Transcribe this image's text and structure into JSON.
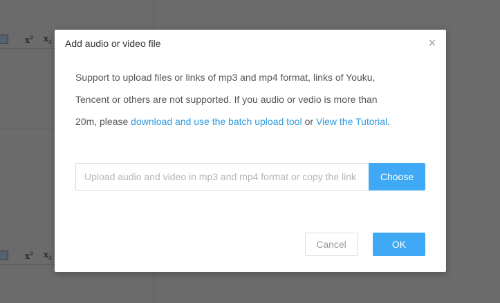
{
  "background": {
    "toolbar": {
      "superscript_label": "x",
      "superscript_mark": "2",
      "subscript_label": "x",
      "subscript_mark": "2"
    }
  },
  "dialog": {
    "title": "Add audio or video file",
    "close_glyph": "×",
    "body": {
      "line1": "Support to upload files or links of mp3 and mp4 format, links of Youku,",
      "line2": "Tencent or others are not supported. If you audio or vedio is more than",
      "line3_prefix": "20m, please ",
      "batch_link": "download and use the batch upload tool",
      "or_text": " or ",
      "tutorial_link": "View the Tutorial",
      "line3_suffix": "."
    },
    "upload": {
      "placeholder": "Upload audio and video in mp3 and mp4 format or copy the link",
      "choose_label": "Choose"
    },
    "buttons": {
      "cancel_label": "Cancel",
      "ok_label": "OK"
    }
  },
  "colors": {
    "overlay": "#6b6b6b",
    "accent": "#3fa9f5",
    "link": "#2e9be0"
  }
}
